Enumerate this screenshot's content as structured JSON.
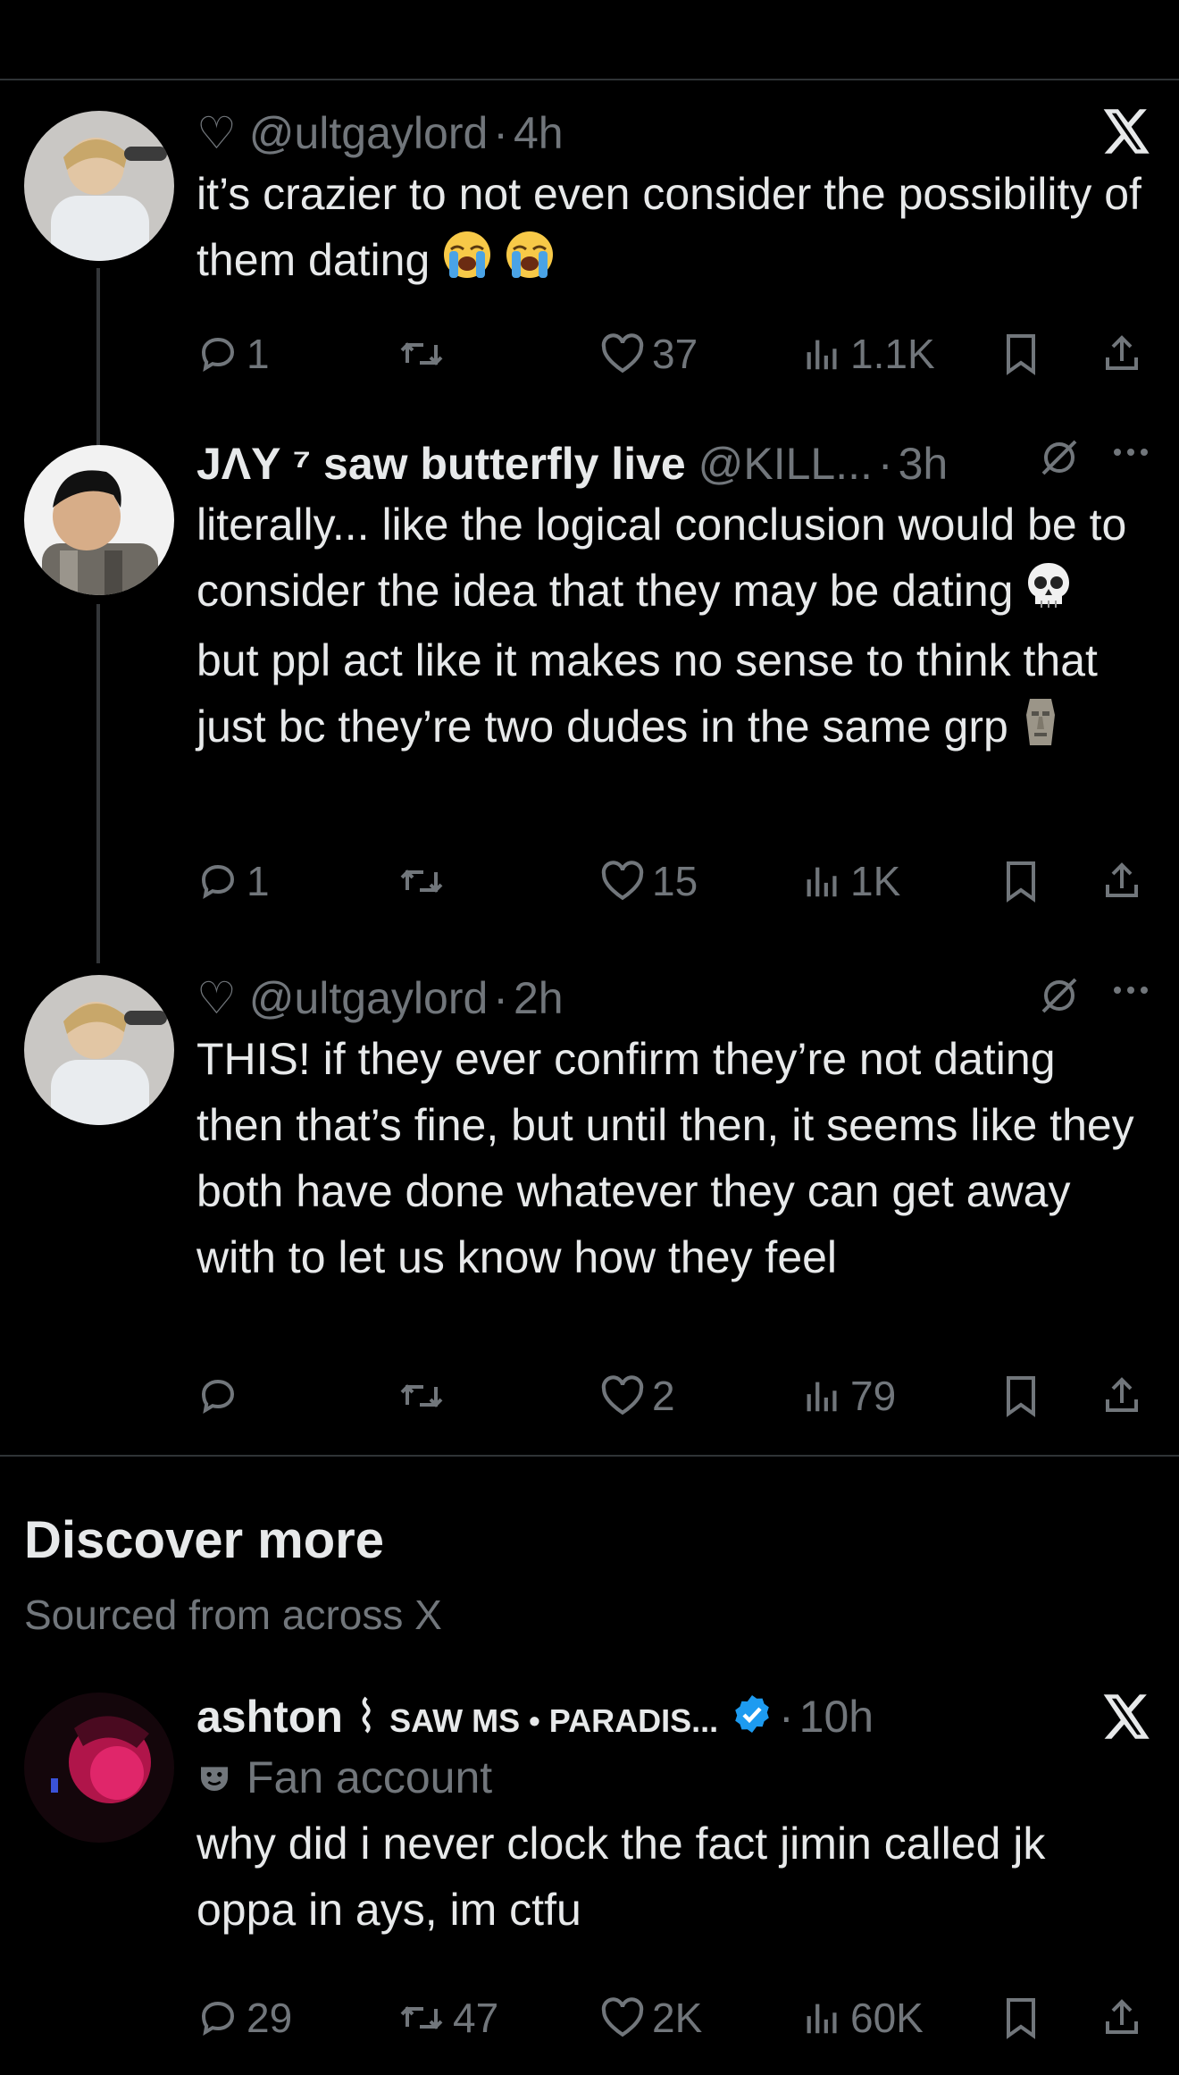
{
  "tweets": [
    {
      "heart_prefix": "♡",
      "handle": "@ultgaylord",
      "time": "4h",
      "body": "it’s crazier to not even consider the possibility of them dating",
      "emoji": [
        "crying-face",
        "crying-face"
      ],
      "replies": "1",
      "retweets": "",
      "likes": "37",
      "views": "1.1K",
      "corner_icon": "x-logo-icon"
    },
    {
      "name": "JΛY ⁷ saw butterfly live",
      "handle": "@KILL...",
      "time": "3h",
      "body_1": "literally... like the logical conclusion would be to consider the idea that they may be dating",
      "body_2": "but ppl act like it makes no sense to think that just bc they’re two dudes in the same grp",
      "emoji": [
        "skull",
        "moai"
      ],
      "replies": "1",
      "retweets": "",
      "likes": "15",
      "views": "1K",
      "corner_icon": "grok-icon"
    },
    {
      "heart_prefix": "♡",
      "handle": "@ultgaylord",
      "time": "2h",
      "body": "THIS! if they ever confirm they’re not dating then that’s fine, but until then, it seems like they both have done whatever they can get away with to let us know how they feel",
      "replies": "",
      "retweets": "",
      "likes": "2",
      "views": "79",
      "corner_icon": "grok-icon"
    }
  ],
  "discover": {
    "title": "Discover more",
    "subtitle": "Sourced from across X"
  },
  "discover_tweet": {
    "name": "ashton",
    "name_suffix": "SAW MS • PARADIS...",
    "time": "10h",
    "label": "Fan account",
    "body": "why did i never clock the fact jimin called jk oppa in ays, im ctfu",
    "replies": "29",
    "retweets": "47",
    "likes": "2K",
    "views": "60K",
    "corner_icon": "x-logo-icon"
  },
  "colors": {
    "background": "#000000",
    "text": "#e7e9ea",
    "secondary": "#71767b",
    "divider": "#2f3336",
    "verified": "#1d9bf0"
  }
}
